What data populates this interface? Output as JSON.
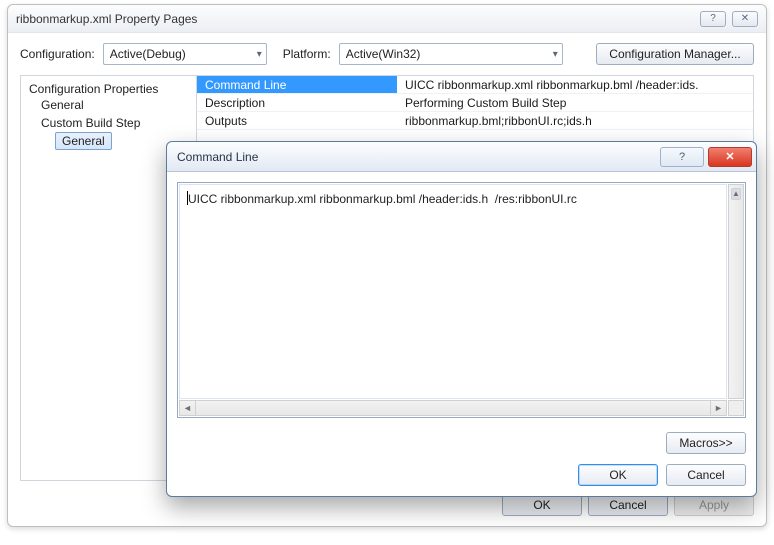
{
  "propertyPages": {
    "title": "ribbonmarkup.xml Property Pages",
    "configLabel": "Configuration:",
    "configValue": "Active(Debug)",
    "platformLabel": "Platform:",
    "platformValue": "Active(Win32)",
    "configMgrLabel": "Configuration Manager...",
    "tree": {
      "root": "Configuration Properties",
      "general": "General",
      "customBuildStep": "Custom Build Step",
      "csGeneral": "General"
    },
    "grid": [
      {
        "name": "Command Line",
        "value": "UICC ribbonmarkup.xml ribbonmarkup.bml /header:ids."
      },
      {
        "name": "Description",
        "value": "Performing Custom Build Step"
      },
      {
        "name": "Outputs",
        "value": "ribbonmarkup.bml;ribbonUI.rc;ids.h"
      }
    ],
    "buttons": {
      "ok": "OK",
      "cancel": "Cancel",
      "apply": "Apply"
    }
  },
  "commandLineDialog": {
    "title": "Command Line",
    "text": "UICC ribbonmarkup.xml ribbonmarkup.bml /header:ids.h  /res:ribbonUI.rc",
    "buttons": {
      "macros": "Macros>>",
      "ok": "OK",
      "cancel": "Cancel"
    }
  },
  "glyphs": {
    "help": "?",
    "close": "✕",
    "chevDown": "▾",
    "left": "◄",
    "right": "►",
    "up": "▲"
  }
}
